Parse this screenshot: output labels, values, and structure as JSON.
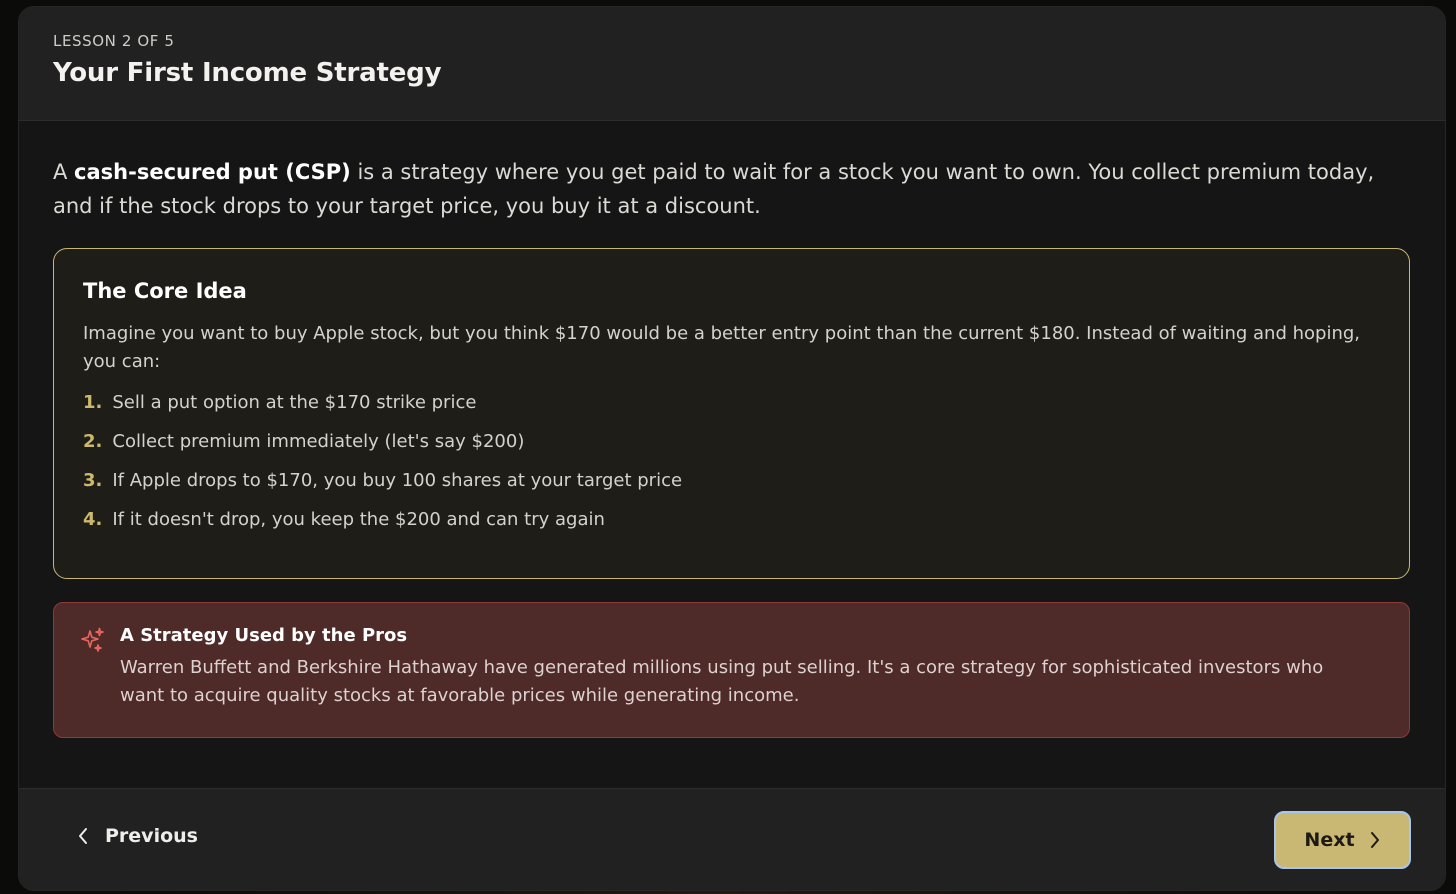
{
  "header": {
    "lesson_label": "LESSON 2 OF 5",
    "title": "Your First Income Strategy"
  },
  "intro": {
    "prefix": "A ",
    "term": "cash-secured put (CSP)",
    "suffix": " is a strategy where you get paid to wait for a stock you want to own. You collect premium today, and if the stock drops to your target price, you buy it at a discount."
  },
  "core_idea": {
    "title": "The Core Idea",
    "body": "Imagine you want to buy Apple stock, but you think $170 would be a better entry point than the current $180. Instead of waiting and hoping, you can:",
    "steps": [
      {
        "num": "1.",
        "text": "Sell a put option at the $170 strike price"
      },
      {
        "num": "2.",
        "text": "Collect premium immediately (let's say $200)"
      },
      {
        "num": "3.",
        "text": "If Apple drops to $170, you buy 100 shares at your target price"
      },
      {
        "num": "4.",
        "text": "If it doesn't drop, you keep the $200 and can try again"
      }
    ]
  },
  "pro_tip": {
    "icon": "sparkles-icon",
    "title": "A Strategy Used by the Pros",
    "body": "Warren Buffett and Berkshire Hathaway have generated millions using put selling. It's a core strategy for sophisticated investors who want to acquire quality stocks at favorable prices while generating income."
  },
  "footer": {
    "previous_label": "Previous",
    "next_label": "Next"
  },
  "colors": {
    "accent_gold": "#c9b874",
    "card_border_gold": "#c8b76f",
    "tip_background": "#4e2a28",
    "tip_border": "#8e3b37",
    "tip_icon": "#e8675f"
  }
}
